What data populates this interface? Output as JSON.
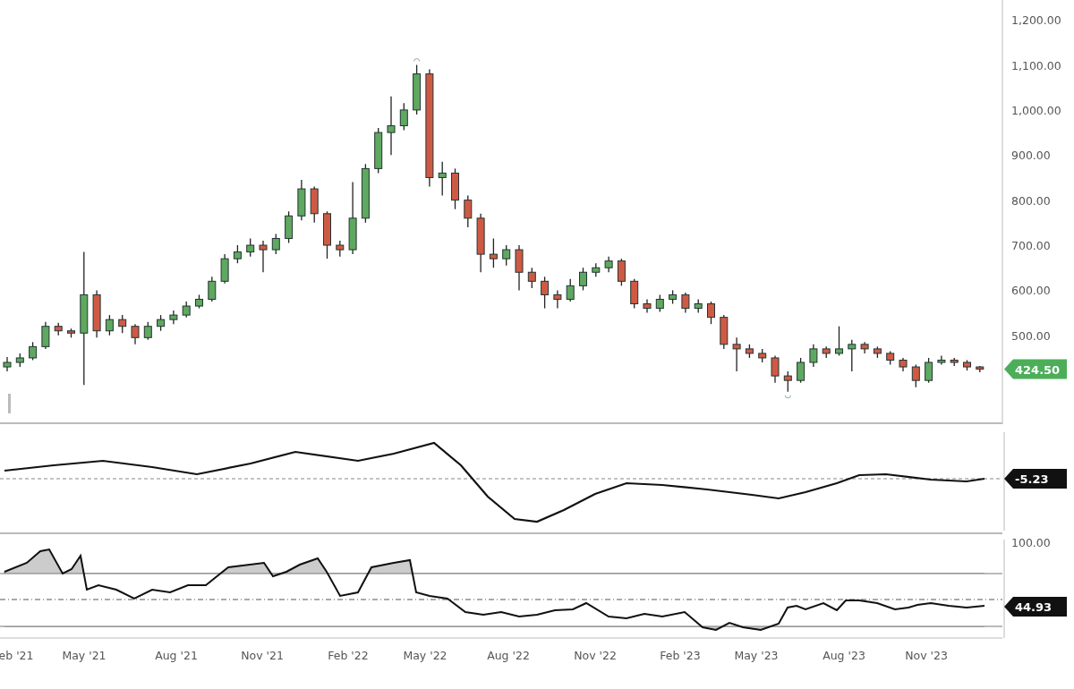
{
  "price_chart": {
    "last_price": "424.50",
    "chart_data": {
      "type": "candlestick",
      "ylim": [
        307,
        1244
      ],
      "yticks": [
        {
          "value": 500,
          "label": "500.00"
        },
        {
          "value": 600,
          "label": "600.00"
        },
        {
          "value": 700,
          "label": "700.00"
        },
        {
          "value": 800,
          "label": "800.00"
        },
        {
          "value": 900,
          "label": "900.00"
        },
        {
          "value": 1000,
          "label": "1,000.00"
        },
        {
          "value": 1100,
          "label": "1,100.00"
        },
        {
          "value": 1200,
          "label": "1,200.00"
        }
      ],
      "ohlc": [
        [
          430,
          452,
          420,
          440
        ],
        [
          440,
          460,
          430,
          450
        ],
        [
          450,
          485,
          445,
          475
        ],
        [
          475,
          530,
          470,
          520
        ],
        [
          520,
          528,
          500,
          510
        ],
        [
          510,
          515,
          495,
          505
        ],
        [
          505,
          685,
          390,
          590
        ],
        [
          590,
          600,
          495,
          510
        ],
        [
          510,
          545,
          500,
          535
        ],
        [
          535,
          545,
          505,
          520
        ],
        [
          520,
          525,
          480,
          495
        ],
        [
          495,
          530,
          490,
          520
        ],
        [
          520,
          545,
          510,
          535
        ],
        [
          535,
          555,
          525,
          545
        ],
        [
          545,
          575,
          540,
          565
        ],
        [
          565,
          590,
          560,
          580
        ],
        [
          580,
          630,
          575,
          620
        ],
        [
          620,
          680,
          615,
          670
        ],
        [
          670,
          700,
          660,
          685
        ],
        [
          685,
          715,
          675,
          700
        ],
        [
          700,
          710,
          640,
          690
        ],
        [
          690,
          725,
          680,
          715
        ],
        [
          715,
          775,
          705,
          765
        ],
        [
          765,
          845,
          755,
          825
        ],
        [
          825,
          830,
          750,
          770
        ],
        [
          770,
          775,
          670,
          700
        ],
        [
          700,
          710,
          675,
          690
        ],
        [
          690,
          840,
          680,
          760
        ],
        [
          760,
          880,
          750,
          870
        ],
        [
          870,
          960,
          860,
          950
        ],
        [
          950,
          1030,
          900,
          965
        ],
        [
          965,
          1015,
          955,
          1000
        ],
        [
          1000,
          1100,
          990,
          1080
        ],
        [
          1080,
          1090,
          830,
          850
        ],
        [
          850,
          885,
          810,
          860
        ],
        [
          860,
          870,
          780,
          800
        ],
        [
          800,
          810,
          740,
          760
        ],
        [
          760,
          770,
          640,
          680
        ],
        [
          680,
          715,
          650,
          670
        ],
        [
          670,
          700,
          655,
          690
        ],
        [
          690,
          700,
          600,
          640
        ],
        [
          640,
          650,
          605,
          620
        ],
        [
          620,
          630,
          560,
          590
        ],
        [
          590,
          600,
          560,
          580
        ],
        [
          580,
          625,
          575,
          610
        ],
        [
          610,
          650,
          600,
          640
        ],
        [
          640,
          660,
          630,
          650
        ],
        [
          650,
          675,
          640,
          665
        ],
        [
          665,
          670,
          610,
          620
        ],
        [
          620,
          625,
          560,
          570
        ],
        [
          570,
          580,
          550,
          560
        ],
        [
          560,
          590,
          552,
          580
        ],
        [
          580,
          600,
          570,
          590
        ],
        [
          590,
          595,
          550,
          560
        ],
        [
          560,
          580,
          550,
          570
        ],
        [
          570,
          575,
          525,
          540
        ],
        [
          540,
          545,
          470,
          480
        ],
        [
          480,
          495,
          420,
          470
        ],
        [
          470,
          480,
          450,
          460
        ],
        [
          460,
          470,
          440,
          450
        ],
        [
          450,
          455,
          395,
          410
        ],
        [
          410,
          420,
          375,
          400
        ],
        [
          400,
          450,
          395,
          440
        ],
        [
          440,
          480,
          430,
          470
        ],
        [
          470,
          475,
          450,
          460
        ],
        [
          460,
          520,
          455,
          470
        ],
        [
          470,
          490,
          420,
          480
        ],
        [
          480,
          485,
          460,
          470
        ],
        [
          470,
          475,
          450,
          460
        ],
        [
          460,
          465,
          435,
          445
        ],
        [
          445,
          450,
          420,
          430
        ],
        [
          430,
          435,
          385,
          400
        ],
        [
          400,
          450,
          395,
          440
        ],
        [
          440,
          455,
          435,
          445
        ],
        [
          445,
          450,
          432,
          440
        ],
        [
          440,
          445,
          422,
          430
        ],
        [
          430,
          432,
          418,
          425
        ]
      ]
    }
  },
  "macd_panel": {
    "reading": "-5.23"
  },
  "date_axis": [
    "eb '21",
    "May '21",
    "Aug '21",
    "Nov '21",
    "Feb '22",
    "May '22",
    "Aug '22",
    "Nov '22",
    "Feb '23",
    "May '23",
    "Aug '23",
    "Nov '23"
  ],
  "oscillator_panel": {
    "axis_label": "100.00",
    "reading": "44.93"
  }
}
